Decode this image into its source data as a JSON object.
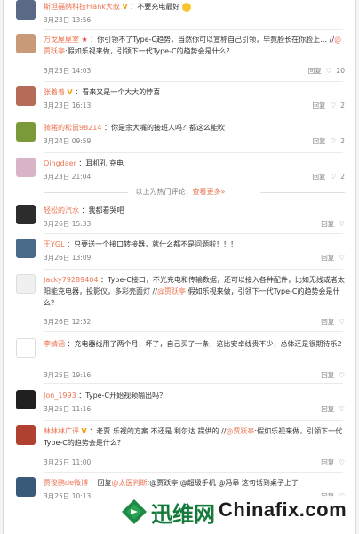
{
  "comments": [
    {
      "name": "斯坦福纳科技Frank大叔",
      "text": "：不要充电最好",
      "date": "3月23日 13:56",
      "reply": "",
      "like": "",
      "av": "#5a6a86"
    },
    {
      "name": "万戈屋屋室",
      "text": "：你引领不了Type-C趋势，当然你可以宣称自己引领，毕竟脸长在你脸上…",
      "reply_pre": "//",
      "at": "@贾跃亭",
      "quote": ":假如乐视来做，引领下一代Type-C的趋势会是什么？",
      "date": "3月23日 14:03",
      "replylabel": "回复",
      "like": "20",
      "av": "#c89a78"
    },
    {
      "name": "张着着",
      "text": "：看来又是一个大大的悖喜",
      "date": "3月23日 16:13",
      "replylabel": "回复",
      "like": "2",
      "av": "#b46c58"
    },
    {
      "name": "骑猪的松鼠98214",
      "text": "：你是余大嘴的接班人吗？都这么能吹",
      "date": "3月24日 09:59",
      "replylabel": "回复",
      "like": "2",
      "av": "#7a9a3a"
    },
    {
      "name": "Qingdaer",
      "text": "：耳机孔 充电",
      "date": "3月23日 21:04",
      "replylabel": "回复",
      "like": "2",
      "av": "#d8b4c8"
    }
  ],
  "hot_divider": {
    "text": "以上为热门评论，",
    "link": "查看更多»"
  },
  "comments2": [
    {
      "name": "轻松的汽水",
      "text": "：我都看哭吧",
      "date": "3月26日 15:33",
      "replylabel": "回复",
      "like": "",
      "av": "#2c2c2c"
    },
    {
      "name": "王YGL",
      "text": "：只要送一个接口转接器，就什么都不是问题啦！！！",
      "date": "3月26日 13:09",
      "replylabel": "回复",
      "like": "",
      "av": "#4a6a8a"
    },
    {
      "name": "Jacky79289404",
      "text": "：Type-C接口，不光充电和传输数据，还可以接入各种配件，比如无线或者太阳能充电器，投影仪，多彩壳面灯",
      "reply_pre": "//",
      "at": "@贾跃亭",
      "quote": ":假如乐视来做，引领下一代Type-C的趋势会是什么？",
      "date": "3月26日 12:32",
      "replylabel": "回复",
      "like": "",
      "av": "#f0f0f0"
    },
    {
      "name": "李婧涵",
      "text": "：充电器线用了两个月，坏了，自己买了一条，这比安卓线贵不少，总体还是很期待乐2",
      "date": "3月25日 19:16",
      "replylabel": "回复",
      "like": "",
      "av": "#ffffff"
    },
    {
      "name": "Jon_1993",
      "text": "：Type-C开始视频输出吗？",
      "date": "3月25日 11:16",
      "replylabel": "回复",
      "like": "",
      "av": "#202020"
    },
    {
      "name": "林林林广评",
      "text": "：老贾 乐视的方案 不还是 利尔达 提供的 //",
      "at": "@贾跃亭",
      "quote": ":假如乐视来做，引领下一代Type-C的趋势会是什么？",
      "date": "3月25日 11:00",
      "replylabel": "回复",
      "like": "",
      "av": "#b04030"
    },
    {
      "name": "贾俊鹏de微博",
      "text": "：回复",
      "at": "@太医判断",
      "tail": ":@贾跃亭 @超级手机 @冯皋 这句话到桌子上了",
      "date": "3月25日 10:13",
      "replylabel": "回复",
      "like": "",
      "av": "#3a5a7a"
    }
  ],
  "watermark": {
    "cn": "迅维网",
    "en": "Chinafix.com"
  }
}
